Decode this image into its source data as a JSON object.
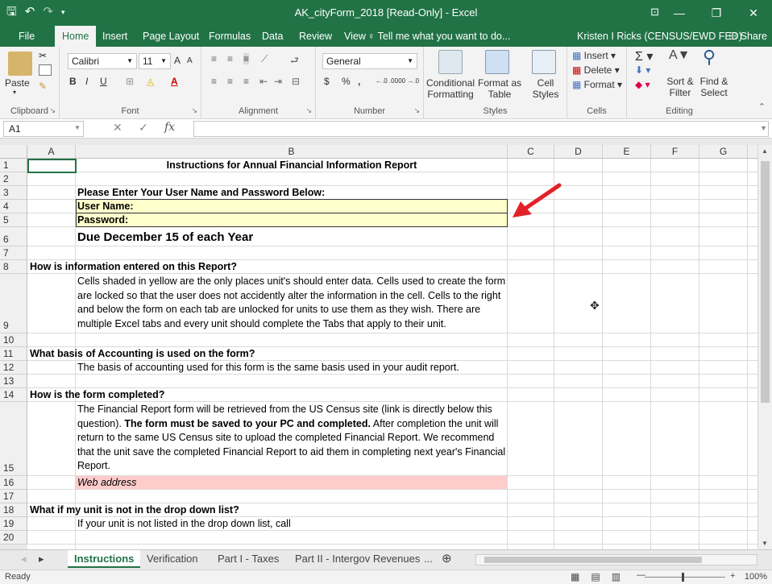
{
  "window": {
    "title": "AK_cityForm_2018  [Read-Only]  -  Excel",
    "minimize": "—",
    "restore": "❐",
    "close": "✕",
    "ribbon_display": "⊡"
  },
  "ribbon_tabs": [
    {
      "label": "File"
    },
    {
      "label": "Home"
    },
    {
      "label": "Insert"
    },
    {
      "label": "Page Layout"
    },
    {
      "label": "Formulas"
    },
    {
      "label": "Data"
    },
    {
      "label": "Review"
    },
    {
      "label": "View"
    }
  ],
  "tell_me": "Tell me what you want to do...",
  "user": "Kristen I Ricks (CENSUS/EWD FED)",
  "share": "Share",
  "ribbon": {
    "clipboard": {
      "paste": "Paste",
      "label": "Clipboard"
    },
    "font": {
      "name": "Calibri",
      "size": "11",
      "bold": "B",
      "italic": "I",
      "underline": "U",
      "grow": "A",
      "shrink": "A",
      "color": "A",
      "label": "Font"
    },
    "alignment": {
      "label": "Alignment"
    },
    "number": {
      "format": "General",
      "currency": "$",
      "percent": "%",
      "comma": ",",
      "inc_decimal": "←.0 .00",
      "dec_decimal": ".00 →.0",
      "label": "Number"
    },
    "styles": {
      "conditional": "Conditional",
      "conditional2": "Formatting",
      "format_as": "Format as",
      "format_as2": "Table",
      "cell": "Cell",
      "cell2": "Styles",
      "label": "Styles"
    },
    "cells": {
      "insert": "Insert",
      "delete": "Delete",
      "format": "Format",
      "label": "Cells"
    },
    "editing": {
      "sort": "Sort &",
      "sort2": "Filter",
      "find": "Find &",
      "find2": "Select",
      "label": "Editing"
    }
  },
  "formula_bar": {
    "name_box": "A1",
    "cancel": "✕",
    "enter": "✓",
    "fx": "fx",
    "value": ""
  },
  "columns": [
    "A",
    "B",
    "C",
    "D",
    "E",
    "F",
    "G"
  ],
  "rows": [
    "1",
    "2",
    "3",
    "4",
    "5",
    "6",
    "7",
    "8",
    "9",
    "10",
    "11",
    "12",
    "13",
    "14",
    "15",
    "16",
    "17",
    "18",
    "19",
    "20"
  ],
  "cells": {
    "r1_b": "Instructions for Annual Financial Information Report",
    "r3_b": "Please  Enter Your User Name and Password Below:",
    "r4_b": "User Name:",
    "r5_b": "Password:",
    "r6_b": "Due December 15 of each Year",
    "r8_a": "How is information entered on this Report?",
    "r9_b": "Cells shaded in yellow are the only places unit's should enter data.  Cells used to create the form are locked so that the user does not accidently alter the information in the cell.  Cells to the right and below the form on each tab are unlocked for units to use them as they wish.  There are multiple Excel tabs and every unit should complete the Tabs that apply to their unit.",
    "r11_a": "What basis of Accounting is used on the form?",
    "r12_b": "The basis of accounting used for this form is the same basis used in your audit report.",
    "r14_a": "How is the form completed?",
    "r15_b_1": "The Financial Report form will be retrieved from the US Census site (link is directly below this question).  ",
    "r15_b_bold": "The form must be saved to your PC and completed.",
    "r15_b_2": "  After completion the unit will return to the same US Census site to upload the completed Financial Report.  We recommend that the unit save the completed Financial Report to aid them in completing next year's Financial Report.",
    "r16_b": "Web address",
    "r18_a": "What if my unit is not in the drop down list?",
    "r19_b": "If your unit is not listed in the drop down list, call"
  },
  "sheet_tabs": [
    {
      "label": "Instructions",
      "active": true
    },
    {
      "label": "Verification"
    },
    {
      "label": "Part I - Taxes"
    },
    {
      "label": "Part II - Intergov Revenues"
    }
  ],
  "sheet_more": "...",
  "status": {
    "ready": "Ready",
    "zoom": "100%",
    "zoom_minus": "—",
    "zoom_plus": "+"
  },
  "colors": {
    "excel_green": "#217346",
    "yellow_fill": "#ffffcc",
    "pink_fill": "#ffcccc",
    "arrow_red": "#e3202a"
  }
}
